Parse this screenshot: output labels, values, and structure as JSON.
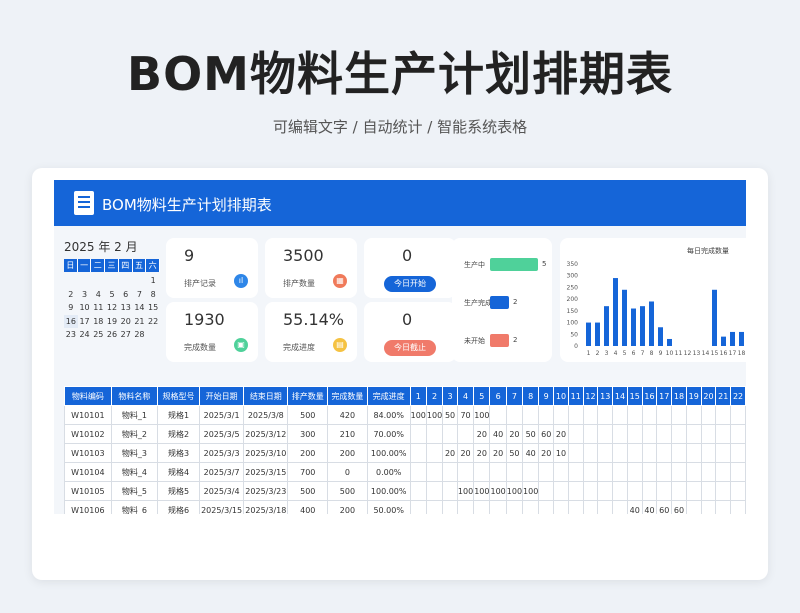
{
  "hero": {
    "title": "BOM物料生产计划排期表",
    "subtitle": "可编辑文字 / 自动统计 / 智能系统表格"
  },
  "banner": {
    "title": "BOM物料生产计划排期表",
    "icon": "list-document-icon"
  },
  "calendar": {
    "year_month": "2025 年 2 月",
    "weekdays": [
      "日",
      "一",
      "二",
      "三",
      "四",
      "五",
      "六"
    ],
    "days": [
      "",
      "",
      "",
      "",
      "",
      "",
      "1",
      "2",
      "3",
      "4",
      "5",
      "6",
      "7",
      "8",
      "9",
      "10",
      "11",
      "12",
      "13",
      "14",
      "15",
      "16",
      "17",
      "18",
      "19",
      "20",
      "21",
      "22",
      "23",
      "24",
      "25",
      "26",
      "27",
      "28",
      ""
    ],
    "selected_day": "16"
  },
  "stats": {
    "records": {
      "value": "9",
      "label": "排产记录",
      "color": "#2e86e8"
    },
    "quantity": {
      "value": "3500",
      "label": "排产数量",
      "color": "#f07a5a"
    },
    "completed": {
      "value": "1930",
      "label": "完成数量",
      "color": "#4fd19a"
    },
    "progress": {
      "value": "55.14%",
      "label": "完成进度",
      "color": "#f5c242"
    },
    "today_start": {
      "value": "0",
      "label": "今日开始",
      "color": "#1565d8"
    },
    "today_due": {
      "value": "0",
      "label": "今日截止",
      "color": "#f07a6a"
    }
  },
  "status": [
    {
      "label": "生产中",
      "value": 5,
      "color": "#4fd19a"
    },
    {
      "label": "生产完成",
      "value": 2,
      "color": "#1565d8"
    },
    {
      "label": "未开始",
      "value": 2,
      "color": "#f07a6a"
    }
  ],
  "chart_data": {
    "type": "bar",
    "title": "每日完成数量",
    "categories": [
      "1",
      "2",
      "3",
      "4",
      "5",
      "6",
      "7",
      "8",
      "9",
      "10",
      "11",
      "12",
      "13",
      "14",
      "15",
      "16",
      "17",
      "18"
    ],
    "values": [
      100,
      100,
      170,
      290,
      240,
      160,
      170,
      190,
      80,
      30,
      0,
      0,
      0,
      0,
      240,
      40,
      60,
      60
    ],
    "ylim": [
      0,
      350
    ],
    "yticks": [
      "350",
      "300",
      "250",
      "200",
      "150",
      "100",
      "50",
      "0"
    ],
    "color": "#1565d8"
  },
  "table": {
    "headers": [
      "物料编码",
      "物料名称",
      "规格型号",
      "开始日期",
      "结束日期",
      "排产数量",
      "完成数量",
      "完成进度"
    ],
    "day_headers": [
      "1",
      "2",
      "3",
      "4",
      "5",
      "6",
      "7",
      "8",
      "9",
      "10",
      "11",
      "12",
      "13",
      "14",
      "15",
      "16",
      "17",
      "18",
      "19",
      "20",
      "21",
      "22"
    ],
    "rows": [
      {
        "cells": [
          "W10101",
          "物料_1",
          "规格1",
          "2025/3/1",
          "2025/3/8",
          "500",
          "420",
          "84.00%"
        ],
        "days": [
          "100",
          "100",
          "50",
          "70",
          "100",
          "",
          "",
          "",
          "",
          "",
          "",
          "",
          "",
          "",
          "",
          "",
          "",
          "",
          "",
          "",
          "",
          ""
        ]
      },
      {
        "cells": [
          "W10102",
          "物料_2",
          "规格2",
          "2025/3/5",
          "2025/3/12",
          "300",
          "210",
          "70.00%"
        ],
        "days": [
          "",
          "",
          "",
          "",
          "20",
          "40",
          "20",
          "50",
          "60",
          "20",
          "",
          "",
          "",
          "",
          "",
          "",
          "",
          "",
          "",
          "",
          "",
          ""
        ]
      },
      {
        "cells": [
          "W10103",
          "物料_3",
          "规格3",
          "2025/3/3",
          "2025/3/10",
          "200",
          "200",
          "100.00%"
        ],
        "days": [
          "",
          "",
          "20",
          "20",
          "20",
          "20",
          "50",
          "40",
          "20",
          "10",
          "",
          "",
          "",
          "",
          "",
          "",
          "",
          "",
          "",
          "",
          "",
          ""
        ]
      },
      {
        "cells": [
          "W10104",
          "物料_4",
          "规格4",
          "2025/3/7",
          "2025/3/15",
          "700",
          "0",
          "0.00%"
        ],
        "days": [
          "",
          "",
          "",
          "",
          "",
          "",
          "",
          "",
          "",
          "",
          "",
          "",
          "",
          "",
          "",
          "",
          "",
          "",
          "",
          "",
          "",
          ""
        ]
      },
      {
        "cells": [
          "W10105",
          "物料_5",
          "规格5",
          "2025/3/4",
          "2025/3/23",
          "500",
          "500",
          "100.00%"
        ],
        "days": [
          "",
          "",
          "",
          "100",
          "100",
          "100",
          "100",
          "100",
          "",
          "",
          "",
          "",
          "",
          "",
          "",
          "",
          "",
          "",
          "",
          "",
          "",
          ""
        ]
      },
      {
        "cells": [
          "W10106",
          "物料_6",
          "规格6",
          "2025/3/15",
          "2025/3/18",
          "400",
          "200",
          "50.00%"
        ],
        "days": [
          "",
          "",
          "",
          "",
          "",
          "",
          "",
          "",
          "",
          "",
          "",
          "",
          "",
          "",
          "40",
          "40",
          "60",
          "60",
          "",
          "",
          "",
          ""
        ]
      }
    ]
  }
}
